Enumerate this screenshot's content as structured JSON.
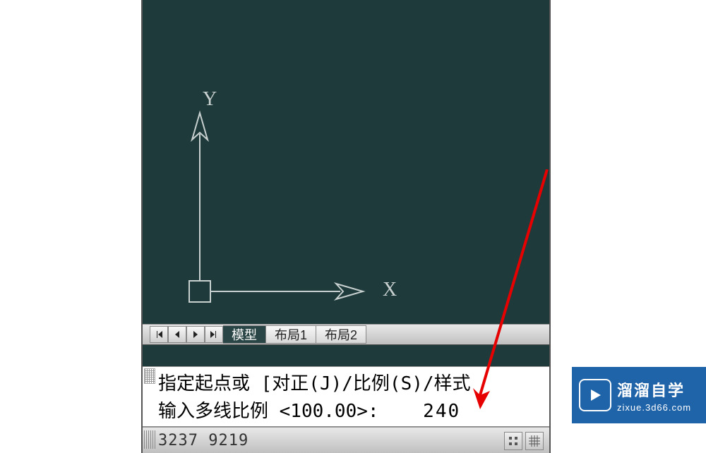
{
  "canvas": {
    "axis_y_label": "Y",
    "axis_x_label": "X"
  },
  "tabs": {
    "model": "模型",
    "layout1": "布局1",
    "layout2": "布局2"
  },
  "command": {
    "line1": "指定起点或 [对正(J)/比例(S)/样式",
    "line2_prompt": "输入多线比例 <100.00>:",
    "line2_input": "240"
  },
  "status": {
    "coords": "3237 9219"
  },
  "watermark": {
    "title": "溜溜自学",
    "url": "zixue.3d66.com"
  }
}
